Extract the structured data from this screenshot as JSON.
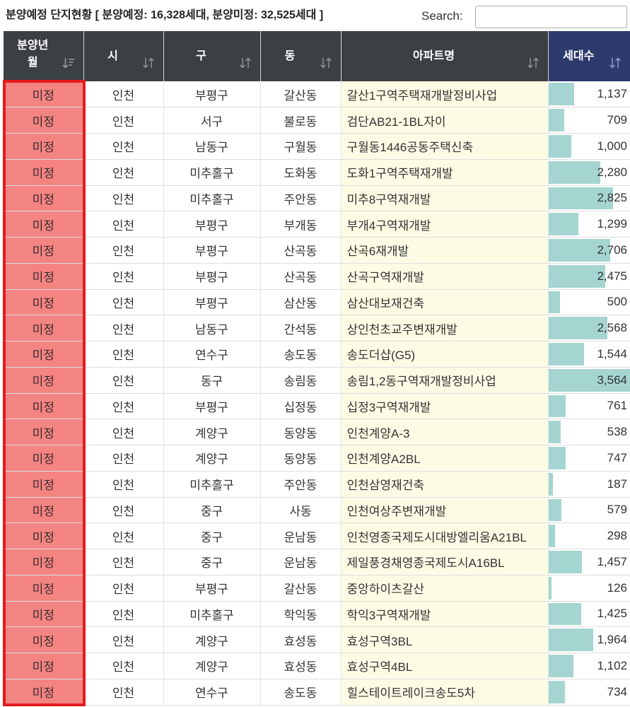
{
  "title": "분양예정 단지현황 [ 분양예정: 16,328세대, 분양미정: 32,525세대 ]",
  "search": {
    "label": "Search:",
    "value": ""
  },
  "table": {
    "columns": [
      {
        "label": "분양년월",
        "sort_icon": "sort-desc-icon"
      },
      {
        "label": "시",
        "sort_icon": "sort-icon"
      },
      {
        "label": "구",
        "sort_icon": "sort-icon"
      },
      {
        "label": "동",
        "sort_icon": "sort-icon"
      },
      {
        "label": "아파트명",
        "sort_icon": "sort-icon"
      },
      {
        "label": "세대수",
        "sort_icon": "sort-icon"
      }
    ],
    "rows": [
      {
        "month": "미정",
        "city": "인천",
        "gu": "부평구",
        "dong": "갈산동",
        "apt": "갈산1구역주택재개발정비사업",
        "units": "1,137"
      },
      {
        "month": "미정",
        "city": "인천",
        "gu": "서구",
        "dong": "불로동",
        "apt": "검단AB21-1BL자이",
        "units": "709"
      },
      {
        "month": "미정",
        "city": "인천",
        "gu": "남동구",
        "dong": "구월동",
        "apt": "구월동1446공동주택신축",
        "units": "1,000"
      },
      {
        "month": "미정",
        "city": "인천",
        "gu": "미추홀구",
        "dong": "도화동",
        "apt": "도화1구역주택재개발",
        "units": "2,280"
      },
      {
        "month": "미정",
        "city": "인천",
        "gu": "미추홀구",
        "dong": "주안동",
        "apt": "미추8구역재개발",
        "units": "2,825"
      },
      {
        "month": "미정",
        "city": "인천",
        "gu": "부평구",
        "dong": "부개동",
        "apt": "부개4구역재개발",
        "units": "1,299"
      },
      {
        "month": "미정",
        "city": "인천",
        "gu": "부평구",
        "dong": "산곡동",
        "apt": "산곡6재개발",
        "units": "2,706"
      },
      {
        "month": "미정",
        "city": "인천",
        "gu": "부평구",
        "dong": "산곡동",
        "apt": "산곡구역재개발",
        "units": "2,475"
      },
      {
        "month": "미정",
        "city": "인천",
        "gu": "부평구",
        "dong": "삼산동",
        "apt": "삼산대보재건축",
        "units": "500"
      },
      {
        "month": "미정",
        "city": "인천",
        "gu": "남동구",
        "dong": "간석동",
        "apt": "상인천초교주변재개발",
        "units": "2,568"
      },
      {
        "month": "미정",
        "city": "인천",
        "gu": "연수구",
        "dong": "송도동",
        "apt": "송도더샵(G5)",
        "units": "1,544"
      },
      {
        "month": "미정",
        "city": "인천",
        "gu": "동구",
        "dong": "송림동",
        "apt": "송림1,2동구역재개발정비사업",
        "units": "3,564"
      },
      {
        "month": "미정",
        "city": "인천",
        "gu": "부평구",
        "dong": "십정동",
        "apt": "십정3구역재개발",
        "units": "761"
      },
      {
        "month": "미정",
        "city": "인천",
        "gu": "계양구",
        "dong": "동양동",
        "apt": "인천계양A-3",
        "units": "538"
      },
      {
        "month": "미정",
        "city": "인천",
        "gu": "계양구",
        "dong": "동양동",
        "apt": "인천계양A2BL",
        "units": "747"
      },
      {
        "month": "미정",
        "city": "인천",
        "gu": "미추홀구",
        "dong": "주안동",
        "apt": "인천삼영재건축",
        "units": "187"
      },
      {
        "month": "미정",
        "city": "인천",
        "gu": "중구",
        "dong": "사동",
        "apt": "인천여상주변재개발",
        "units": "579"
      },
      {
        "month": "미정",
        "city": "인천",
        "gu": "중구",
        "dong": "운남동",
        "apt": "인천영종국제도시대방엘리움A21BL",
        "units": "298"
      },
      {
        "month": "미정",
        "city": "인천",
        "gu": "중구",
        "dong": "운남동",
        "apt": "제일풍경채영종국제도시A16BL",
        "units": "1,457"
      },
      {
        "month": "미정",
        "city": "인천",
        "gu": "부평구",
        "dong": "갈산동",
        "apt": "중앙하이츠갈산",
        "units": "126"
      },
      {
        "month": "미정",
        "city": "인천",
        "gu": "미추홀구",
        "dong": "학익동",
        "apt": "학익3구역재개발",
        "units": "1,425"
      },
      {
        "month": "미정",
        "city": "인천",
        "gu": "계양구",
        "dong": "효성동",
        "apt": "효성구역3BL",
        "units": "1,964"
      },
      {
        "month": "미정",
        "city": "인천",
        "gu": "계양구",
        "dong": "효성동",
        "apt": "효성구역4BL",
        "units": "1,102"
      },
      {
        "month": "미정",
        "city": "인천",
        "gu": "연수구",
        "dong": "송도동",
        "apt": "힐스테이트레이크송도5차",
        "units": "734"
      }
    ]
  },
  "colors": {
    "header_bg": "#3b4044",
    "units_header_bg": "#2c3a6c",
    "month_cell_bg": "#f38482",
    "apt_cell_bg": "#fcfce5",
    "units_bar": "#a5d5d1",
    "highlight_border": "#e41a1c"
  }
}
